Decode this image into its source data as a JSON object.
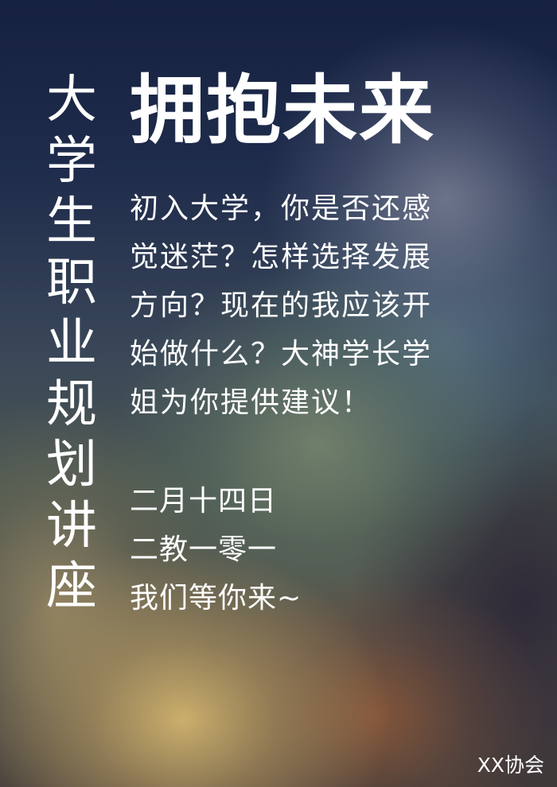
{
  "poster": {
    "vertical_title": "大学生职业规划讲座",
    "main_title": "拥抱未来",
    "intro": "初入大学，你是否还感觉迷茫？怎样选择发展方向？现在的我应该开始做什么？大神学长学姐为你提供建议！",
    "date": "二月十四日",
    "location": "二教一零一",
    "invitation": "我们等你来~",
    "organizer": "XX协会"
  }
}
